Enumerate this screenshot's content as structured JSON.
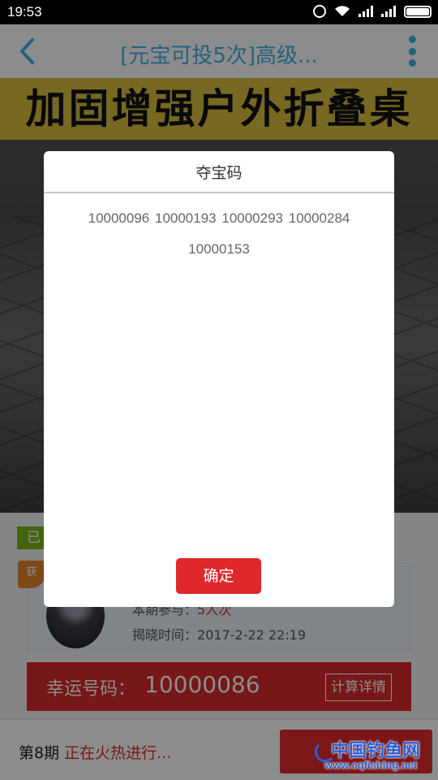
{
  "status_bar": {
    "time": "19:53",
    "icons": [
      "alarm-icon",
      "wifi-icon",
      "signal-icon",
      "signal-icon",
      "battery-icon"
    ]
  },
  "header": {
    "title": "[元宝可投5次]高级...",
    "back_icon": "chevron-left-icon",
    "more_icon": "more-vertical-icon",
    "accent_color": "#3db2e6"
  },
  "product": {
    "banner_text": "加固增强户外折叠桌"
  },
  "page": {
    "status_tag": "已",
    "winner_badge": "获",
    "participation_label": "本期参与：",
    "participation_value": "5人次",
    "reveal_label": "揭晓时间：",
    "reveal_time": "2017-2-22 22:19",
    "lucky_label": "幸运号码：",
    "lucky_number": "10000086",
    "calc_details": "计算详情",
    "period": "第8期",
    "period_status": "正在火热进行..."
  },
  "modal": {
    "title": "夺宝码",
    "codes": [
      "10000096",
      "10000193",
      "10000293",
      "10000284",
      "10000153"
    ],
    "confirm_label": "确定",
    "confirm_color": "#e0282b"
  },
  "watermark": {
    "title": "中国钓鱼网",
    "url": "www.cqfishing.net"
  }
}
